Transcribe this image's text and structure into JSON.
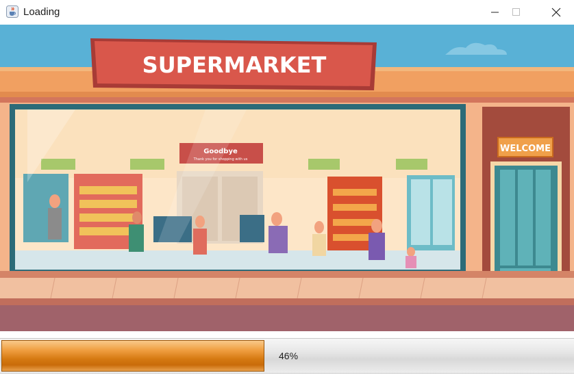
{
  "window": {
    "title": "Loading",
    "app_icon": "java-cup-icon",
    "controls": [
      "minimize-icon",
      "maximize-icon",
      "close-icon"
    ]
  },
  "splash": {
    "store_sign": "SUPERMARKET",
    "inner_sign_title": "Goodbye",
    "inner_sign_subtitle": "Thank you for shopping with us",
    "door_sign": "WELCOME",
    "colors": {
      "sky": "#59b1d6",
      "facade": "#f1a061",
      "sign": "#d9574b",
      "window_frame": "#2c6b78"
    }
  },
  "progress": {
    "label": "46%",
    "value": 0.46,
    "fill_color": "#d67a12"
  }
}
